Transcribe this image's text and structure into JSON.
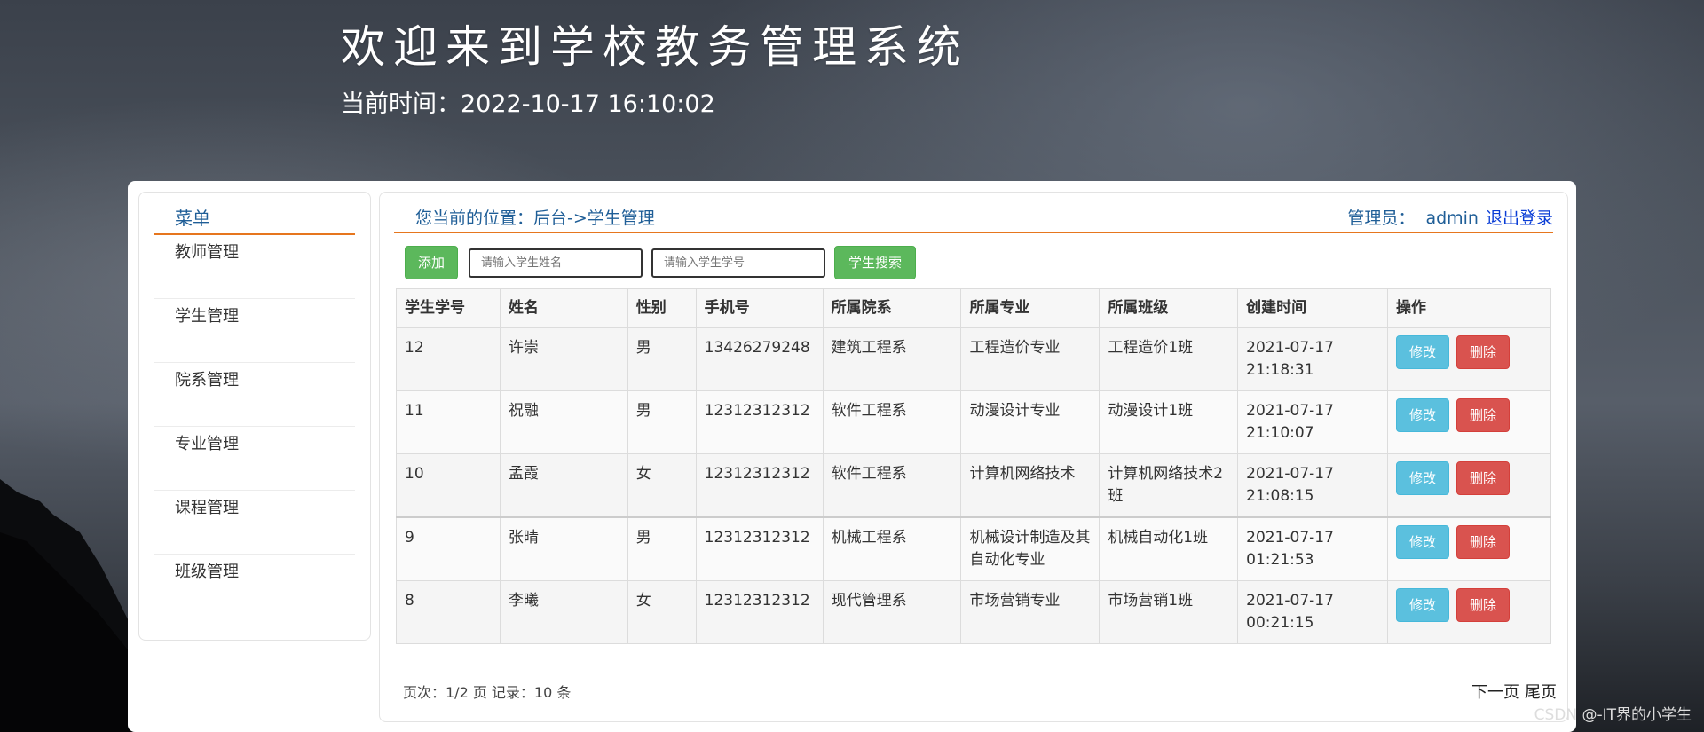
{
  "header": {
    "title": "欢迎来到学校教务管理系统",
    "time_label": "当前时间：",
    "time_value": "2022-10-17 16:10:02"
  },
  "sidebar": {
    "title": "菜单",
    "items": [
      {
        "label": "教师管理"
      },
      {
        "label": "学生管理"
      },
      {
        "label": "院系管理"
      },
      {
        "label": "专业管理"
      },
      {
        "label": "课程管理"
      },
      {
        "label": "班级管理"
      }
    ]
  },
  "topbar": {
    "location": "您当前的位置：后台->学生管理",
    "admin_label": "管理员：",
    "admin_name": "admin",
    "logout": "退出登录"
  },
  "toolbar": {
    "add_label": "添加",
    "name_placeholder": "请输入学生姓名",
    "id_placeholder": "请输入学生学号",
    "search_label": "学生搜索"
  },
  "table": {
    "headers": [
      "学生学号",
      "姓名",
      "性别",
      "手机号",
      "所属院系",
      "所属专业",
      "所属班级",
      "创建时间",
      "操作"
    ],
    "rows": [
      {
        "id": "12",
        "name": "许崇",
        "gender": "男",
        "phone": "13426279248",
        "dept": "建筑工程系",
        "major": "工程造价专业",
        "class": "工程造价1班",
        "created": "2021-07-17 21:18:31"
      },
      {
        "id": "11",
        "name": "祝融",
        "gender": "男",
        "phone": "12312312312",
        "dept": "软件工程系",
        "major": "动漫设计专业",
        "class": "动漫设计1班",
        "created": "2021-07-17 21:10:07"
      },
      {
        "id": "10",
        "name": "孟霞",
        "gender": "女",
        "phone": "12312312312",
        "dept": "软件工程系",
        "major": "计算机网络技术",
        "class": "计算机网络技术2班",
        "created": "2021-07-17 21:08:15"
      },
      {
        "id": "9",
        "name": "张晴",
        "gender": "男",
        "phone": "12312312312",
        "dept": "机械工程系",
        "major": "机械设计制造及其自动化专业",
        "class": "机械自动化1班",
        "created": "2021-07-17 01:21:53"
      },
      {
        "id": "8",
        "name": "李曦",
        "gender": "女",
        "phone": "12312312312",
        "dept": "现代管理系",
        "major": "市场营销专业",
        "class": "市场营销1班",
        "created": "2021-07-17 00:21:15"
      }
    ],
    "edit_label": "修改",
    "delete_label": "删除"
  },
  "pager": {
    "info": "页次：1/2 页 记录：10 条",
    "next": "下一页",
    "last": "尾页"
  },
  "watermark": "CSDN @-IT界的小学生",
  "colors": {
    "accent_orange": "#e6761e",
    "link_blue": "#1f5e97",
    "success_green": "#5cb85c",
    "info_blue": "#5bc0de",
    "danger_red": "#d9534f"
  }
}
